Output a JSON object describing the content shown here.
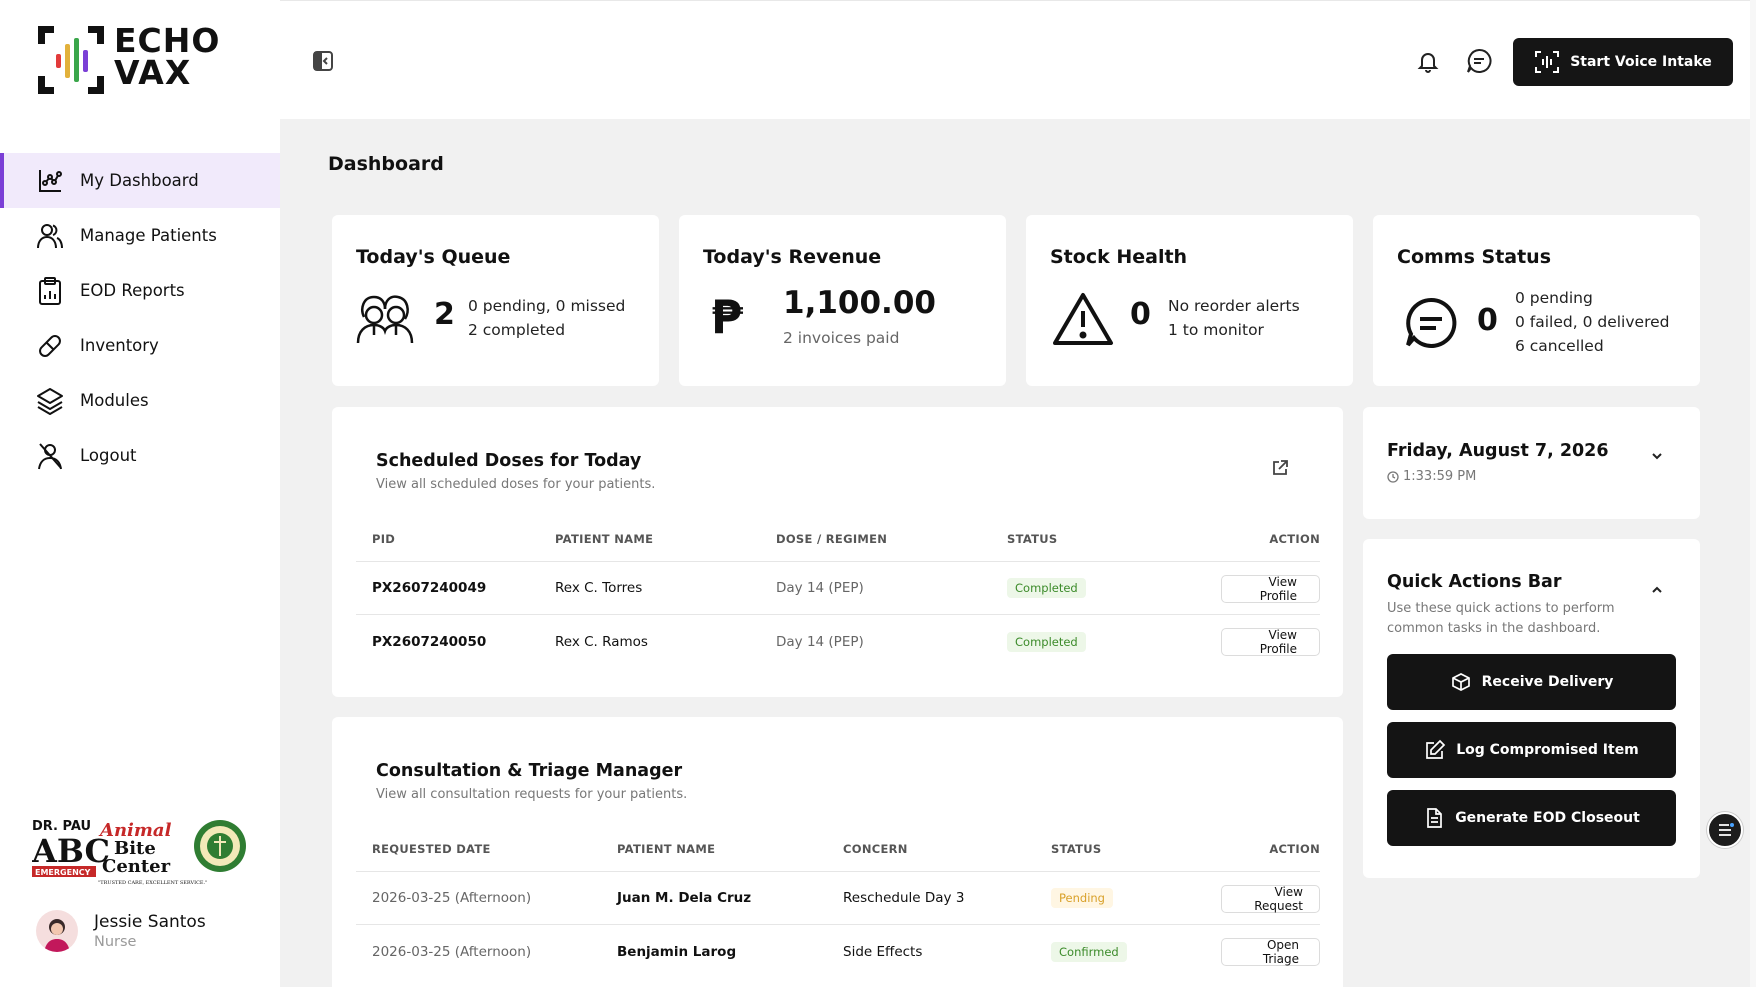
{
  "app": {
    "logo_line1": "ECHO",
    "logo_line2": "VAX"
  },
  "sidebar": {
    "items": [
      {
        "label": "My Dashboard",
        "icon": "chart-icon",
        "active": true
      },
      {
        "label": "Manage Patients",
        "icon": "users-icon"
      },
      {
        "label": "EOD Reports",
        "icon": "clipboard-icon"
      },
      {
        "label": "Inventory",
        "icon": "pill-icon"
      },
      {
        "label": "Modules",
        "icon": "layers-icon"
      },
      {
        "label": "Logout",
        "icon": "logout-icon"
      }
    ],
    "clinic_logo": {
      "line1": "DR. PAU",
      "line2": "ABC",
      "line3": "EMERGENCY",
      "line4": "Animal",
      "line5": "Bite",
      "line6": "Center",
      "tagline": "\"TRUSTED CARE, EXCELLENT SERVICE.\""
    },
    "user": {
      "name": "Jessie Santos",
      "role": "Nurse"
    }
  },
  "topbar": {
    "voice_button": "Start Voice Intake"
  },
  "page": {
    "title": "Dashboard"
  },
  "stats": {
    "queue": {
      "title": "Today's Queue",
      "value": "2",
      "line1": "0 pending, 0 missed",
      "line2": "2 completed"
    },
    "revenue": {
      "title": "Today's Revenue",
      "value": "1,100.00",
      "line1": "2 invoices paid",
      "currency_symbol": "₱"
    },
    "stock": {
      "title": "Stock Health",
      "value": "0",
      "line1": "No reorder alerts",
      "line2": "1 to monitor"
    },
    "comms": {
      "title": "Comms Status",
      "value": "0",
      "line1": "0 pending",
      "line2": "0 failed, 0 delivered",
      "line3": "6 cancelled"
    }
  },
  "doses": {
    "title": "Scheduled Doses for Today",
    "subtitle": "View all scheduled doses for your patients.",
    "headers": [
      "PID",
      "PATIENT NAME",
      "DOSE / REGIMEN",
      "STATUS",
      "ACTION"
    ],
    "rows": [
      {
        "pid": "PX2607240049",
        "name": "Rex C. Torres",
        "dose": "Day 14 (PEP)",
        "status": "Completed",
        "action": "View Profile"
      },
      {
        "pid": "PX2607240050",
        "name": "Rex C. Ramos",
        "dose": "Day 14 (PEP)",
        "status": "Completed",
        "action": "View Profile"
      }
    ]
  },
  "triage": {
    "title": "Consultation & Triage Manager",
    "subtitle": "View all consultation requests for your patients.",
    "headers": [
      "REQUESTED DATE",
      "PATIENT NAME",
      "CONCERN",
      "STATUS",
      "ACTION"
    ],
    "rows": [
      {
        "date": "2026-03-25 (Afternoon)",
        "name": "Juan M. Dela Cruz",
        "concern": "Reschedule Day 3",
        "status": "Pending",
        "action": "View Request"
      },
      {
        "date": "2026-03-25 (Afternoon)",
        "name": "Benjamin Larog",
        "concern": "Side Effects",
        "status": "Confirmed",
        "action": "Open Triage"
      }
    ]
  },
  "datecard": {
    "date": "Friday, August 7, 2026",
    "time": "1:33:59 PM"
  },
  "quick_actions": {
    "title": "Quick Actions Bar",
    "subtitle_line1": "Use these quick actions to perform",
    "subtitle_line2": "common tasks in the dashboard.",
    "buttons": [
      "Receive Delivery",
      "Log Compromised Item",
      "Generate EOD Closeout"
    ]
  },
  "colors": {
    "accent": "#7b3fd6",
    "dark_button": "#141414",
    "completed": "#3c8b2a",
    "pending": "#d9a12a"
  }
}
